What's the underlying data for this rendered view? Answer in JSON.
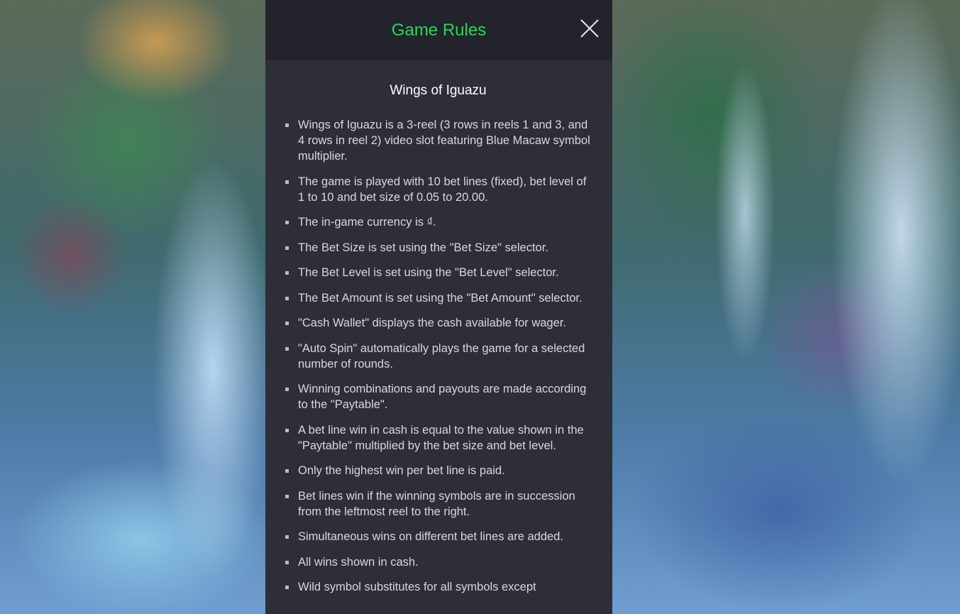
{
  "header": {
    "title": "Game Rules",
    "close_icon": "close-icon"
  },
  "game": {
    "name": "Wings of Iguazu"
  },
  "rules": [
    "Wings of Iguazu is a 3-reel (3 rows in reels 1 and 3, and 4 rows in reel 2) video slot featuring Blue Macaw symbol multiplier.",
    "The game is played with 10 bet lines (fixed), bet level of 1 to 10 and bet size of 0.05 to 20.00.",
    "The in-game currency is ₫.",
    "The Bet Size is set using the \"Bet Size\" selector.",
    "The Bet Level is set using the \"Bet Level\" selector.",
    "The Bet Amount is set using the \"Bet Amount\" selector.",
    "\"Cash Wallet\" displays the cash available for wager.",
    "\"Auto Spin\" automatically plays the game for a selected number of rounds.",
    "Winning combinations and payouts are made according to the \"Paytable\".",
    "A bet line win in cash is equal to the value shown in the \"Paytable\" multiplied by the bet size and bet level.",
    "Only the highest win per bet line is paid.",
    "Bet lines win if the winning symbols are in succession from the leftmost reel to the right.",
    "Simultaneous wins on different bet lines are added.",
    "All wins shown in cash.",
    "Wild symbol substitutes for all symbols except"
  ],
  "colors": {
    "title": "#2bd45a",
    "panel_bg": "#2e2e39",
    "header_bg": "#23232c",
    "text": "#d7d7dc"
  }
}
